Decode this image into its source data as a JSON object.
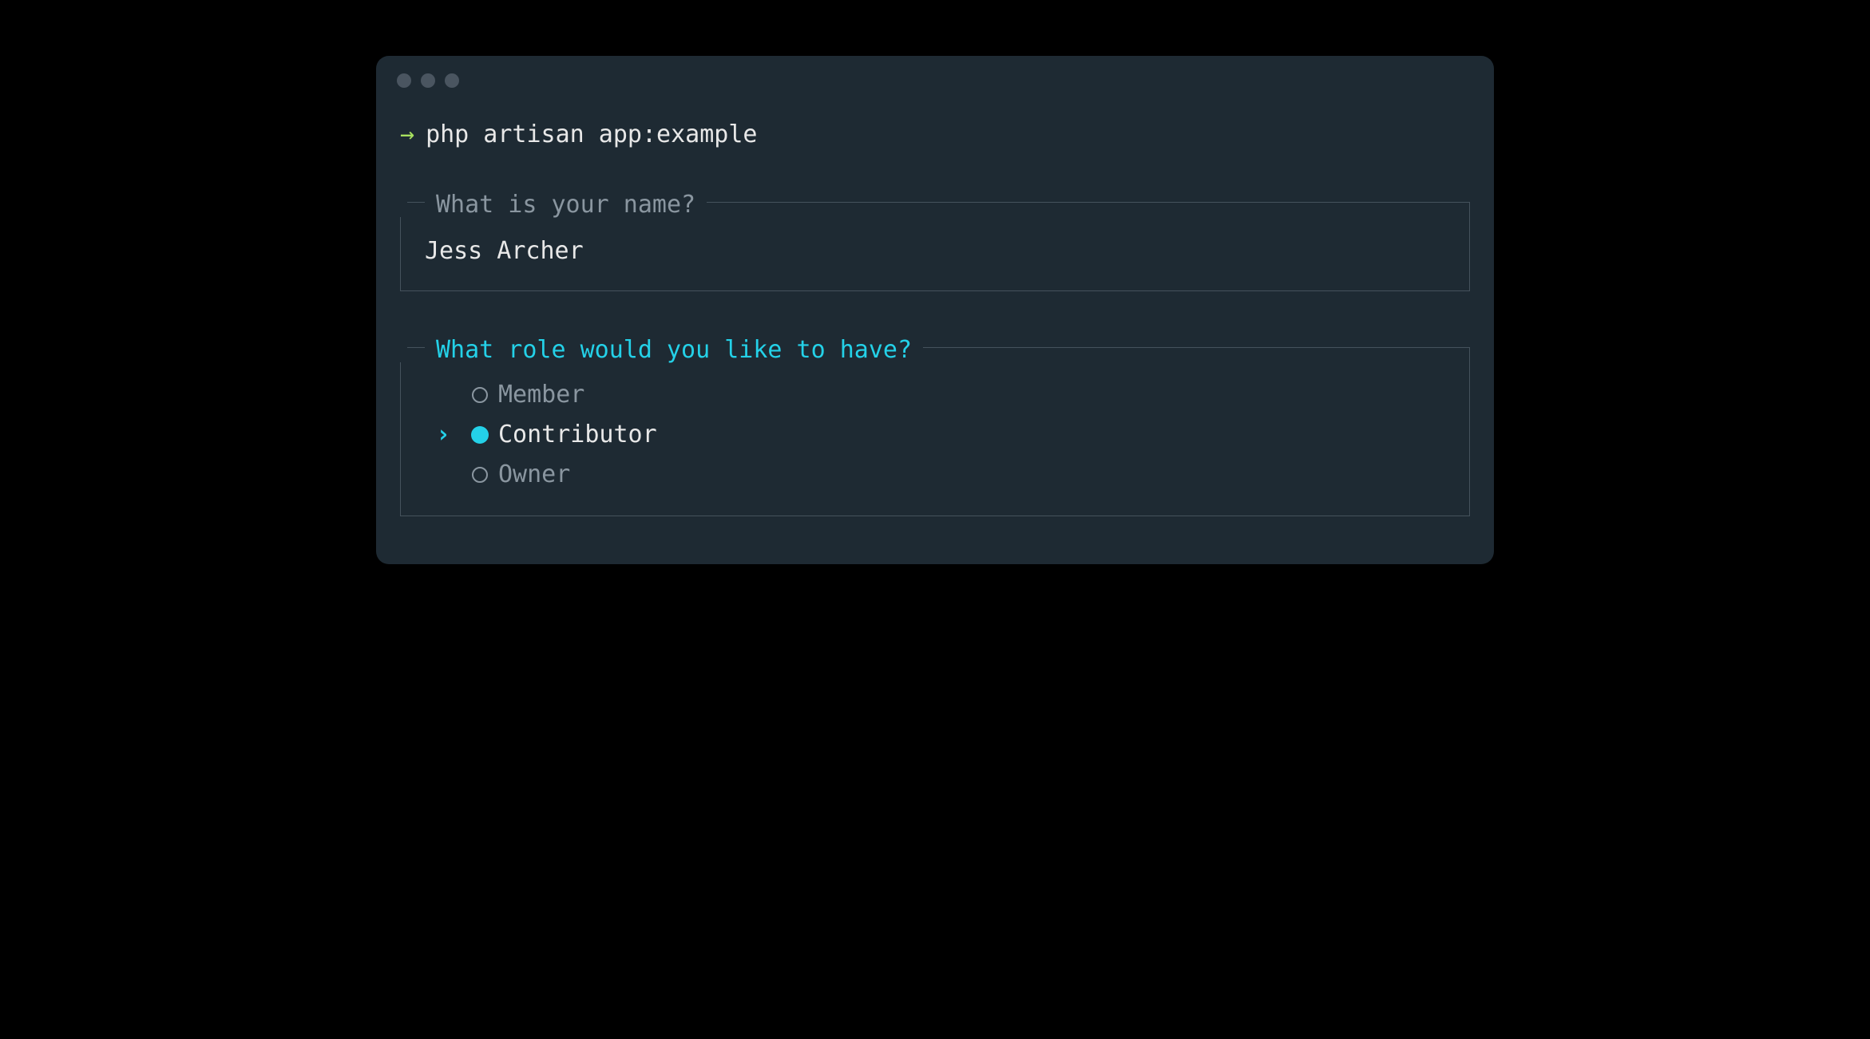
{
  "colors": {
    "background": "#000000",
    "terminal": "#1e2a33",
    "accent_green": "#a8e05f",
    "accent_cyan": "#24d1e8",
    "text_primary": "#e8e8e8",
    "text_muted": "#8a96a0",
    "border": "#45525c"
  },
  "command": {
    "prompt_symbol": "→",
    "text": "php artisan app:example"
  },
  "prompts": [
    {
      "question": "What is your name?",
      "answer": "Jess Archer",
      "active": false
    },
    {
      "question": "What role would you like to have?",
      "active": true,
      "options": [
        {
          "label": "Member",
          "selected": false
        },
        {
          "label": "Contributor",
          "selected": true
        },
        {
          "label": "Owner",
          "selected": false
        }
      ]
    }
  ]
}
